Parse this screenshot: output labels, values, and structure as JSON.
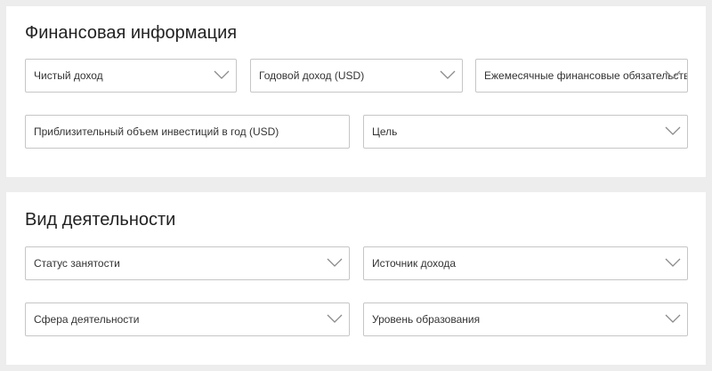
{
  "financial": {
    "title": "Финансовая информация",
    "fields": {
      "net_income": {
        "label": "Чистый доход",
        "type": "select",
        "icon": "chevron-down-icon"
      },
      "annual_income": {
        "label": "Годовой доход (USD)",
        "type": "select",
        "icon": "chevron-down-icon"
      },
      "monthly_obligations": {
        "label": "Ежемесячные финансовые обязательства",
        "type": "select",
        "icon": "chevron-down-icon"
      },
      "annual_investment": {
        "label": "Приблизительный объем инвестиций в год (USD)",
        "type": "input"
      },
      "goal": {
        "label": "Цель",
        "type": "select",
        "icon": "chevron-down-icon"
      }
    }
  },
  "activity": {
    "title": "Вид деятельности",
    "fields": {
      "employment_status": {
        "label": "Статус занятости",
        "type": "select",
        "icon": "chevron-down-icon"
      },
      "income_source": {
        "label": "Источник дохода",
        "type": "select",
        "icon": "chevron-down-icon"
      },
      "industry": {
        "label": "Сфера деятельности",
        "type": "select",
        "icon": "chevron-down-icon"
      },
      "education_level": {
        "label": "Уровень образования",
        "type": "select",
        "icon": "chevron-down-icon"
      }
    }
  },
  "colors": {
    "page_background": "#ededed",
    "card_background": "#ffffff",
    "field_border": "#c6c6c6",
    "chevron": "#8a8a8a",
    "text": "#333333"
  }
}
